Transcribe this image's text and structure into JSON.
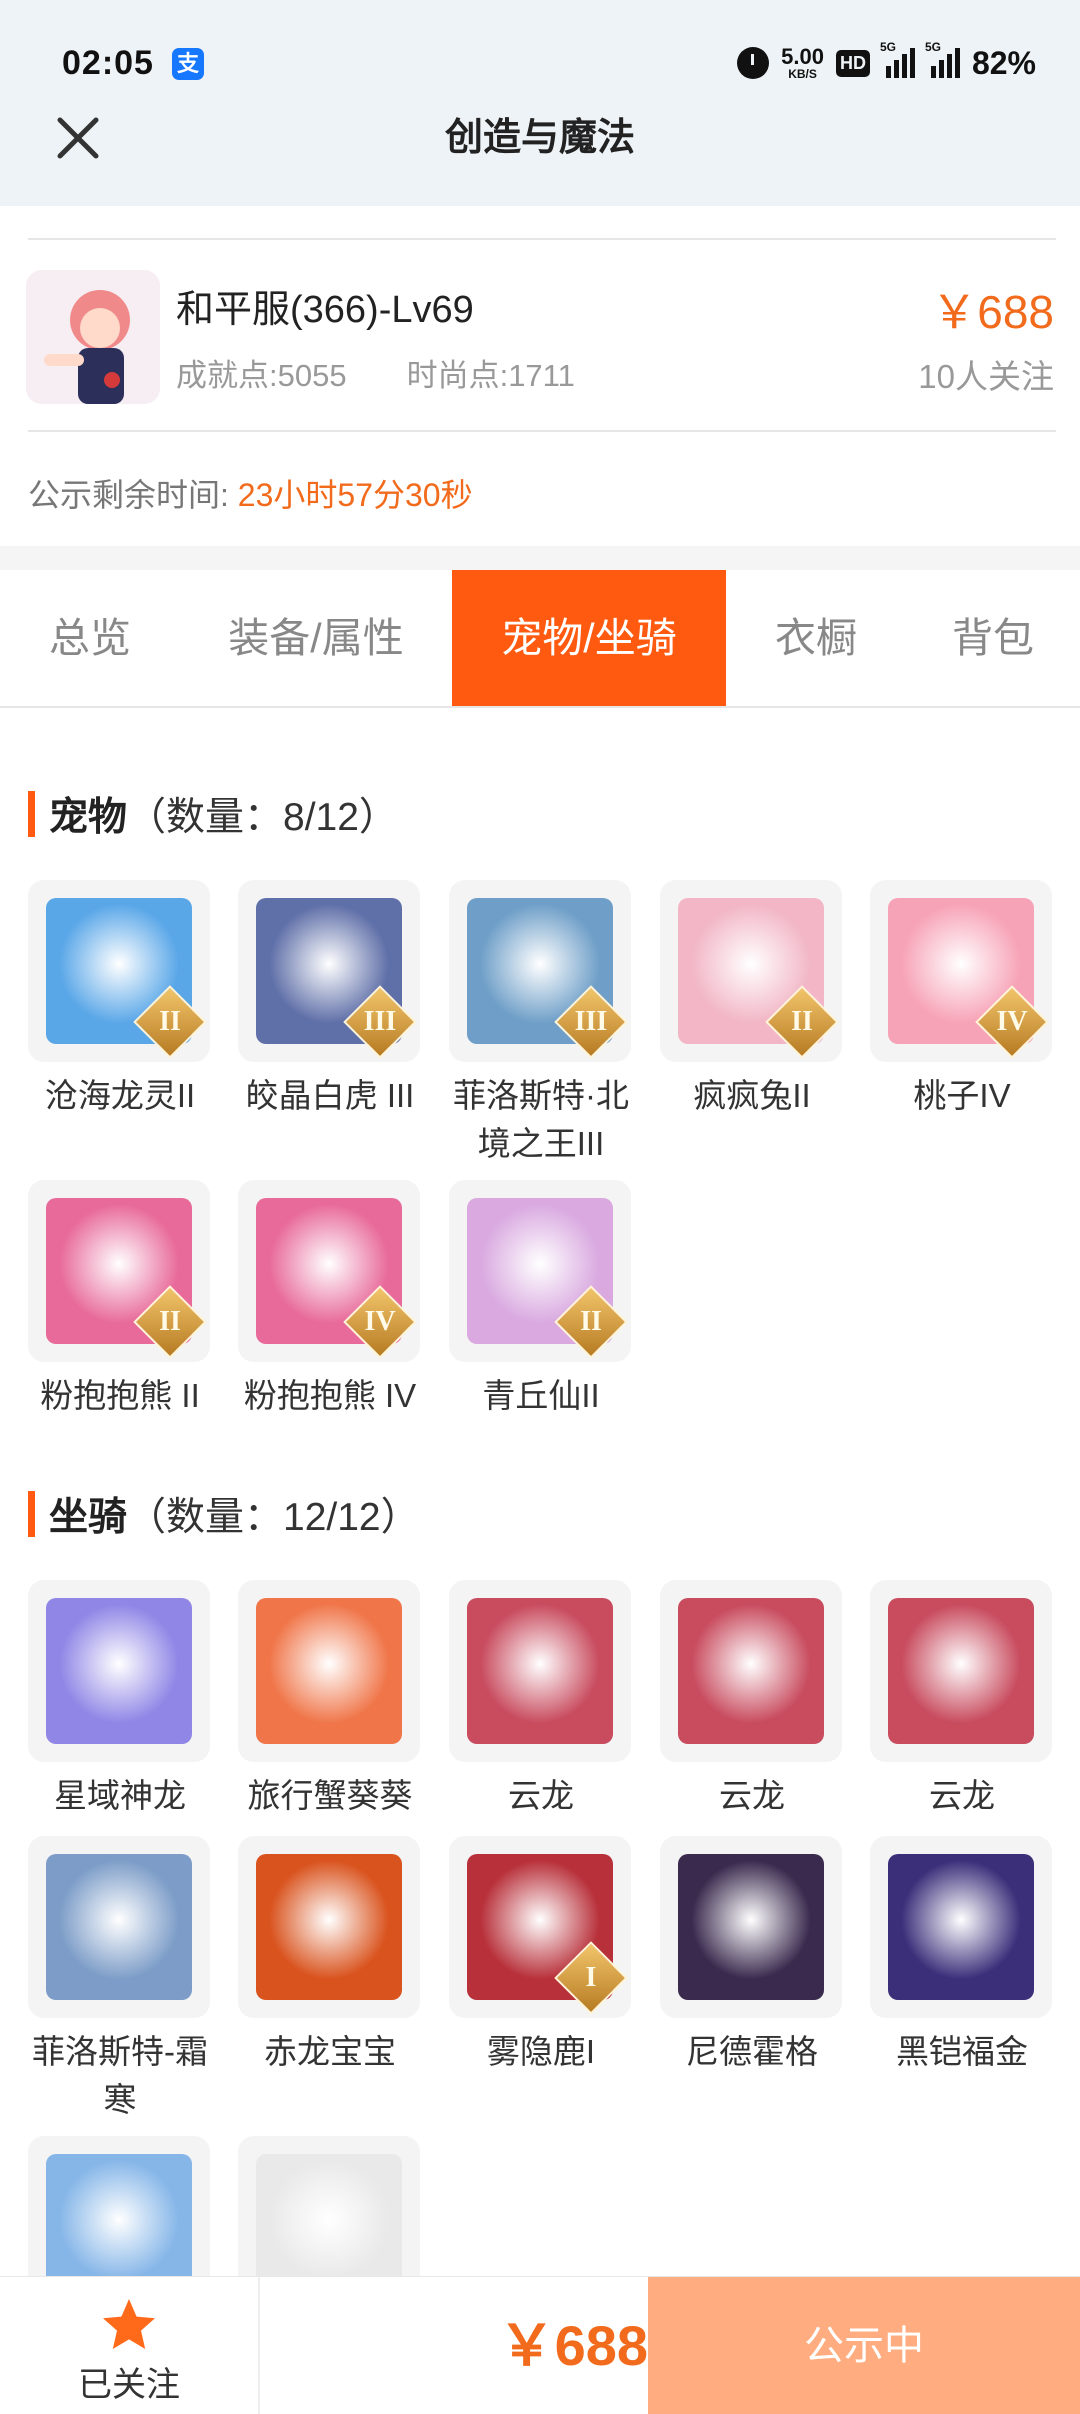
{
  "status_bar": {
    "time": "02:05",
    "alipay_glyph": "支",
    "net_speed_value": "5.00",
    "net_speed_unit": "KB/S",
    "hd_label": "HD",
    "network_5g_1": "5G",
    "network_5g_2": "5G",
    "battery": "82%"
  },
  "header": {
    "title": "创造与魔法",
    "close_icon": "close-icon"
  },
  "account": {
    "server_name": "和平服(366)-Lv69",
    "achievement": "成就点:5055",
    "fashion": "时尚点:1711",
    "price": "￥688",
    "followers": "10人关注",
    "remaining_label": "公示剩余时间:",
    "remaining_value": "23小时57分30秒"
  },
  "tabs": [
    {
      "label": "总览"
    },
    {
      "label": "装备/属性"
    },
    {
      "label": "宠物/坐骑",
      "active": true
    },
    {
      "label": "衣橱"
    },
    {
      "label": "背包"
    }
  ],
  "pets": {
    "title": "宠物",
    "count": "（数量：8/12）",
    "items": [
      {
        "name": "沧海龙灵II",
        "rank": "II",
        "color": "#5aa7e8"
      },
      {
        "name": "皎晶白虎 III",
        "rank": "III",
        "color": "#5f6fa8"
      },
      {
        "name": "菲洛斯特·北境之王III",
        "rank": "III",
        "color": "#6f9fc8"
      },
      {
        "name": "疯疯兔II",
        "rank": "II",
        "color": "#f2b6c6"
      },
      {
        "name": "桃子IV",
        "rank": "IV",
        "color": "#f7a3b7"
      },
      {
        "name": "粉抱抱熊 II",
        "rank": "II",
        "color": "#e86a9a"
      },
      {
        "name": "粉抱抱熊 IV",
        "rank": "IV",
        "color": "#e86a9a"
      },
      {
        "name": "青丘仙II",
        "rank": "II",
        "color": "#d9a9e0"
      }
    ]
  },
  "mounts": {
    "title": "坐骑",
    "count": "（数量：12/12）",
    "items": [
      {
        "name": "星域神龙",
        "rank": "",
        "color": "#8f86e6"
      },
      {
        "name": "旅行蟹葵葵",
        "rank": "",
        "color": "#f0764a"
      },
      {
        "name": "云龙",
        "rank": "",
        "color": "#c84b5e"
      },
      {
        "name": "云龙",
        "rank": "",
        "color": "#c84b5e"
      },
      {
        "name": "云龙",
        "rank": "",
        "color": "#c84b5e"
      },
      {
        "name": "菲洛斯特-霜寒",
        "rank": "",
        "color": "#7d9dc8"
      },
      {
        "name": "赤龙宝宝",
        "rank": "",
        "color": "#d9531e"
      },
      {
        "name": "雾隐鹿I",
        "rank": "I",
        "color": "#b8303a"
      },
      {
        "name": "尼德霍格",
        "rank": "",
        "color": "#3a2a4e"
      },
      {
        "name": "黑铠福金",
        "rank": "",
        "color": "#3b2f7a"
      },
      {
        "name": "",
        "rank": "",
        "color": "#86b6e8"
      },
      {
        "name": "",
        "rank": "",
        "color": "#e9e9e9"
      }
    ]
  },
  "bottom_bar": {
    "follow_label": "已关注",
    "price": "￥688",
    "status_label": "公示中"
  },
  "colors": {
    "accent": "#ff5a10",
    "price": "#f26a1b",
    "status_button": "#ffad80",
    "header_bg": "#eef3f7"
  }
}
